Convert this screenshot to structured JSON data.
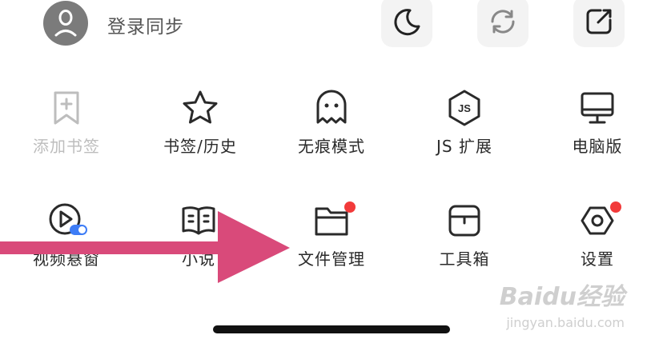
{
  "header": {
    "login_label": "登录同步",
    "buttons": [
      {
        "name": "night-mode",
        "icon": "moon-icon"
      },
      {
        "name": "sync",
        "icon": "sync-icon"
      },
      {
        "name": "edit",
        "icon": "edit-icon"
      }
    ]
  },
  "grid": {
    "row1": [
      {
        "label": "添加书签",
        "icon": "bookmark-add-icon",
        "disabled": true
      },
      {
        "label": "书签/历史",
        "icon": "star-icon"
      },
      {
        "label": "无痕模式",
        "icon": "ghost-icon"
      },
      {
        "label": "JS 扩展",
        "icon": "js-hexagon-icon"
      },
      {
        "label": "电脑版",
        "icon": "desktop-icon"
      }
    ],
    "row2": [
      {
        "label": "视频悬窗",
        "icon": "video-float-icon",
        "toggle": "on"
      },
      {
        "label": "小说",
        "icon": "book-icon"
      },
      {
        "label": "文件管理",
        "icon": "folder-icon",
        "badge": true
      },
      {
        "label": "工具箱",
        "icon": "toolbox-icon"
      },
      {
        "label": "设置",
        "icon": "settings-icon",
        "badge": true
      }
    ]
  },
  "overlay": {
    "arrow": "pointer-arrow-icon",
    "color": "#d94a7a"
  },
  "watermark": {
    "brand": "Baidu经验",
    "url": "jingyan.baidu.com"
  },
  "colors": {
    "badge": "#f23a3a",
    "toggle": "#3d7cf6",
    "icon_stroke": "#2a2a2a",
    "disabled": "#bdbdbd"
  }
}
